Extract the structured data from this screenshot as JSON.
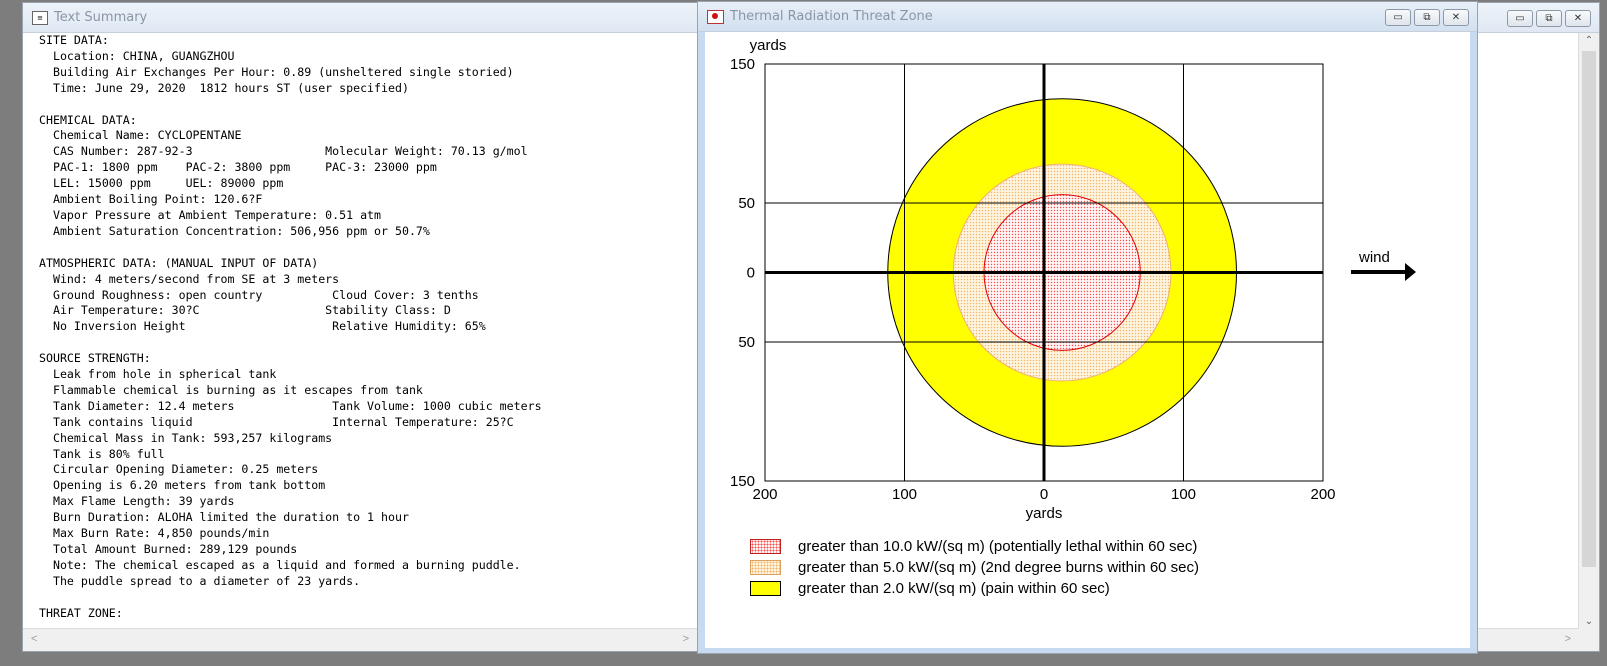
{
  "text_window": {
    "title": "Text Summary",
    "icon": "text-document-icon",
    "lines": [
      "SITE DATA:",
      "  Location: CHINA, GUANGZHOU",
      "  Building Air Exchanges Per Hour: 0.89 (unsheltered single storied)",
      "  Time: June 29, 2020  1812 hours ST (user specified)",
      "",
      "CHEMICAL DATA:",
      "  Chemical Name: CYCLOPENTANE",
      "  CAS Number: 287-92-3                   Molecular Weight: 70.13 g/mol",
      "  PAC-1: 1800 ppm    PAC-2: 3800 ppm     PAC-3: 23000 ppm",
      "  LEL: 15000 ppm     UEL: 89000 ppm",
      "  Ambient Boiling Point: 120.6?F",
      "  Vapor Pressure at Ambient Temperature: 0.51 atm",
      "  Ambient Saturation Concentration: 506,956 ppm or 50.7%",
      "",
      "ATMOSPHERIC DATA: (MANUAL INPUT OF DATA)",
      "  Wind: 4 meters/second from SE at 3 meters",
      "  Ground Roughness: open country          Cloud Cover: 3 tenths",
      "  Air Temperature: 30?C                  Stability Class: D",
      "  No Inversion Height                     Relative Humidity: 65%",
      "",
      "SOURCE STRENGTH:",
      "  Leak from hole in spherical tank",
      "  Flammable chemical is burning as it escapes from tank",
      "  Tank Diameter: 12.4 meters              Tank Volume: 1000 cubic meters",
      "  Tank contains liquid                    Internal Temperature: 25?C",
      "  Chemical Mass in Tank: 593,257 kilograms",
      "  Tank is 80% full",
      "  Circular Opening Diameter: 0.25 meters",
      "  Opening is 6.20 meters from tank bottom",
      "  Max Flame Length: 39 yards",
      "  Burn Duration: ALOHA limited the duration to 1 hour",
      "  Max Burn Rate: 4,850 pounds/min",
      "  Total Amount Burned: 289,129 pounds",
      "  Note: The chemical escaped as a liquid and formed a burning puddle.",
      "  The puddle spread to a diameter of 23 yards.",
      "",
      "THREAT ZONE:"
    ],
    "scroll_left": "<",
    "scroll_right": ">"
  },
  "zone_window": {
    "title": "Thermal Radiation Threat Zone",
    "icon": "thermal-radiation-icon",
    "wind_label": "wind",
    "legend": [
      {
        "text": "greater than 10.0 kW/(sq m) (potentially lethal within 60 sec)",
        "color": "#ff4d4d"
      },
      {
        "text": "greater than 5.0 kW/(sq m) (2nd degree burns within 60 sec)",
        "color": "#f2b36b"
      },
      {
        "text": "greater than 2.0 kW/(sq m) (pain within 60 sec)",
        "color": "#ffff00"
      }
    ]
  },
  "window_buttons": {
    "minimize": "▭",
    "maximize": "⧉",
    "close": "✕"
  },
  "right_window": {
    "scroll_up": "⌃",
    "scroll_down": "⌄",
    "scroll_right": ">"
  },
  "chart_data": {
    "type": "scatter",
    "xlabel": "yards",
    "ylabel": "yards",
    "xlim": [
      -200,
      200
    ],
    "ylim": [
      -150,
      150
    ],
    "x_ticks": [
      -200,
      -100,
      0,
      100,
      200
    ],
    "x_tick_labels": [
      "200",
      "100",
      "0",
      "100",
      "200"
    ],
    "y_ticks": [
      150,
      50,
      0,
      -50,
      -150
    ],
    "y_tick_labels": [
      "150",
      "50",
      "0",
      "50",
      "150"
    ],
    "grid": true,
    "zones": [
      {
        "name": "greater than 2.0 kW/(sq m) (pain within 60 sec)",
        "center_x": 13,
        "center_y": 0,
        "radius": 125,
        "color": "#ffff00"
      },
      {
        "name": "greater than 5.0 kW/(sq m) (2nd degree burns within 60 sec)",
        "center_x": 13,
        "center_y": 0,
        "radius": 78,
        "color": "#f2b36b"
      },
      {
        "name": "greater than 10.0 kW/(sq m) (potentially lethal within 60 sec)",
        "center_x": 13,
        "center_y": 0,
        "radius": 56,
        "color": "#ff4d4d"
      }
    ],
    "legend_position": "bottom-left"
  }
}
